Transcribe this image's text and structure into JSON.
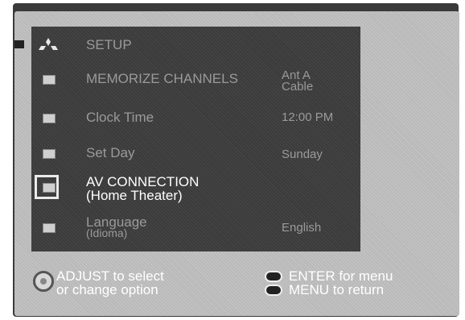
{
  "menu": {
    "title": "SETUP",
    "items": [
      {
        "label": "MEMORIZE CHANNELS",
        "value_line1": "Ant A",
        "value_line2": "Cable"
      },
      {
        "label": "Clock Time",
        "value_line1": "12:00 PM"
      },
      {
        "label": "Set Day",
        "value_line1": "Sunday"
      },
      {
        "label_line1": "AV CONNECTION",
        "label_line2": "(Home Theater)"
      },
      {
        "label_line1": "Language",
        "label_line2": "(Idioma)",
        "value_line1": "English"
      }
    ]
  },
  "footer": {
    "adjust_line1": "ADJUST  to select",
    "adjust_line2": "or change option",
    "enter_line": "ENTER for menu",
    "menu_line": "MENU to return"
  }
}
